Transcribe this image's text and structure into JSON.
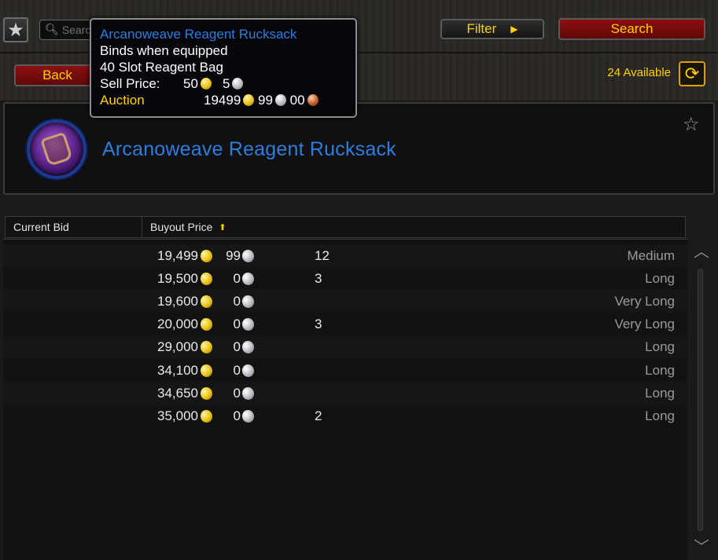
{
  "top_bar": {
    "search_placeholder": "Search",
    "back_label": "Back",
    "filter_label": "Filter",
    "search_label": "Search",
    "available_text": "24 Available"
  },
  "item": {
    "name": "Arcanoweave Reagent Rucksack"
  },
  "tooltip": {
    "title": "Arcanoweave Reagent Rucksack",
    "line1": "Binds when equipped",
    "line2": "40 Slot Reagent Bag",
    "sell_label": "Sell Price:",
    "sell_gold": "50",
    "sell_silver": "5",
    "auction_label": "Auction",
    "auction_gold": "19499",
    "auction_silver": "99",
    "auction_copper": "00"
  },
  "table": {
    "headers": {
      "current_bid": "Current Bid",
      "buyout_price": "Buyout Price"
    },
    "rows": [
      {
        "gold": "19,499",
        "silver": "99",
        "qty": "12",
        "duration": "Medium"
      },
      {
        "gold": "19,500",
        "silver": "0",
        "qty": "3",
        "duration": "Long"
      },
      {
        "gold": "19,600",
        "silver": "0",
        "qty": "",
        "duration": "Very Long"
      },
      {
        "gold": "20,000",
        "silver": "0",
        "qty": "3",
        "duration": "Very Long"
      },
      {
        "gold": "29,000",
        "silver": "0",
        "qty": "",
        "duration": "Long"
      },
      {
        "gold": "34,100",
        "silver": "0",
        "qty": "",
        "duration": "Long"
      },
      {
        "gold": "34,650",
        "silver": "0",
        "qty": "",
        "duration": "Long"
      },
      {
        "gold": "35,000",
        "silver": "0",
        "qty": "2",
        "duration": "Long"
      }
    ]
  },
  "colors": {
    "gold_text": "#ffd100",
    "item_rare_blue": "#2d7de0",
    "button_red": "#8c0f0f"
  },
  "icons": {
    "favorite": "star-icon",
    "search": "magnifier-icon",
    "refresh": "refresh-icon",
    "sort": "sort-up-arrow-icon"
  }
}
